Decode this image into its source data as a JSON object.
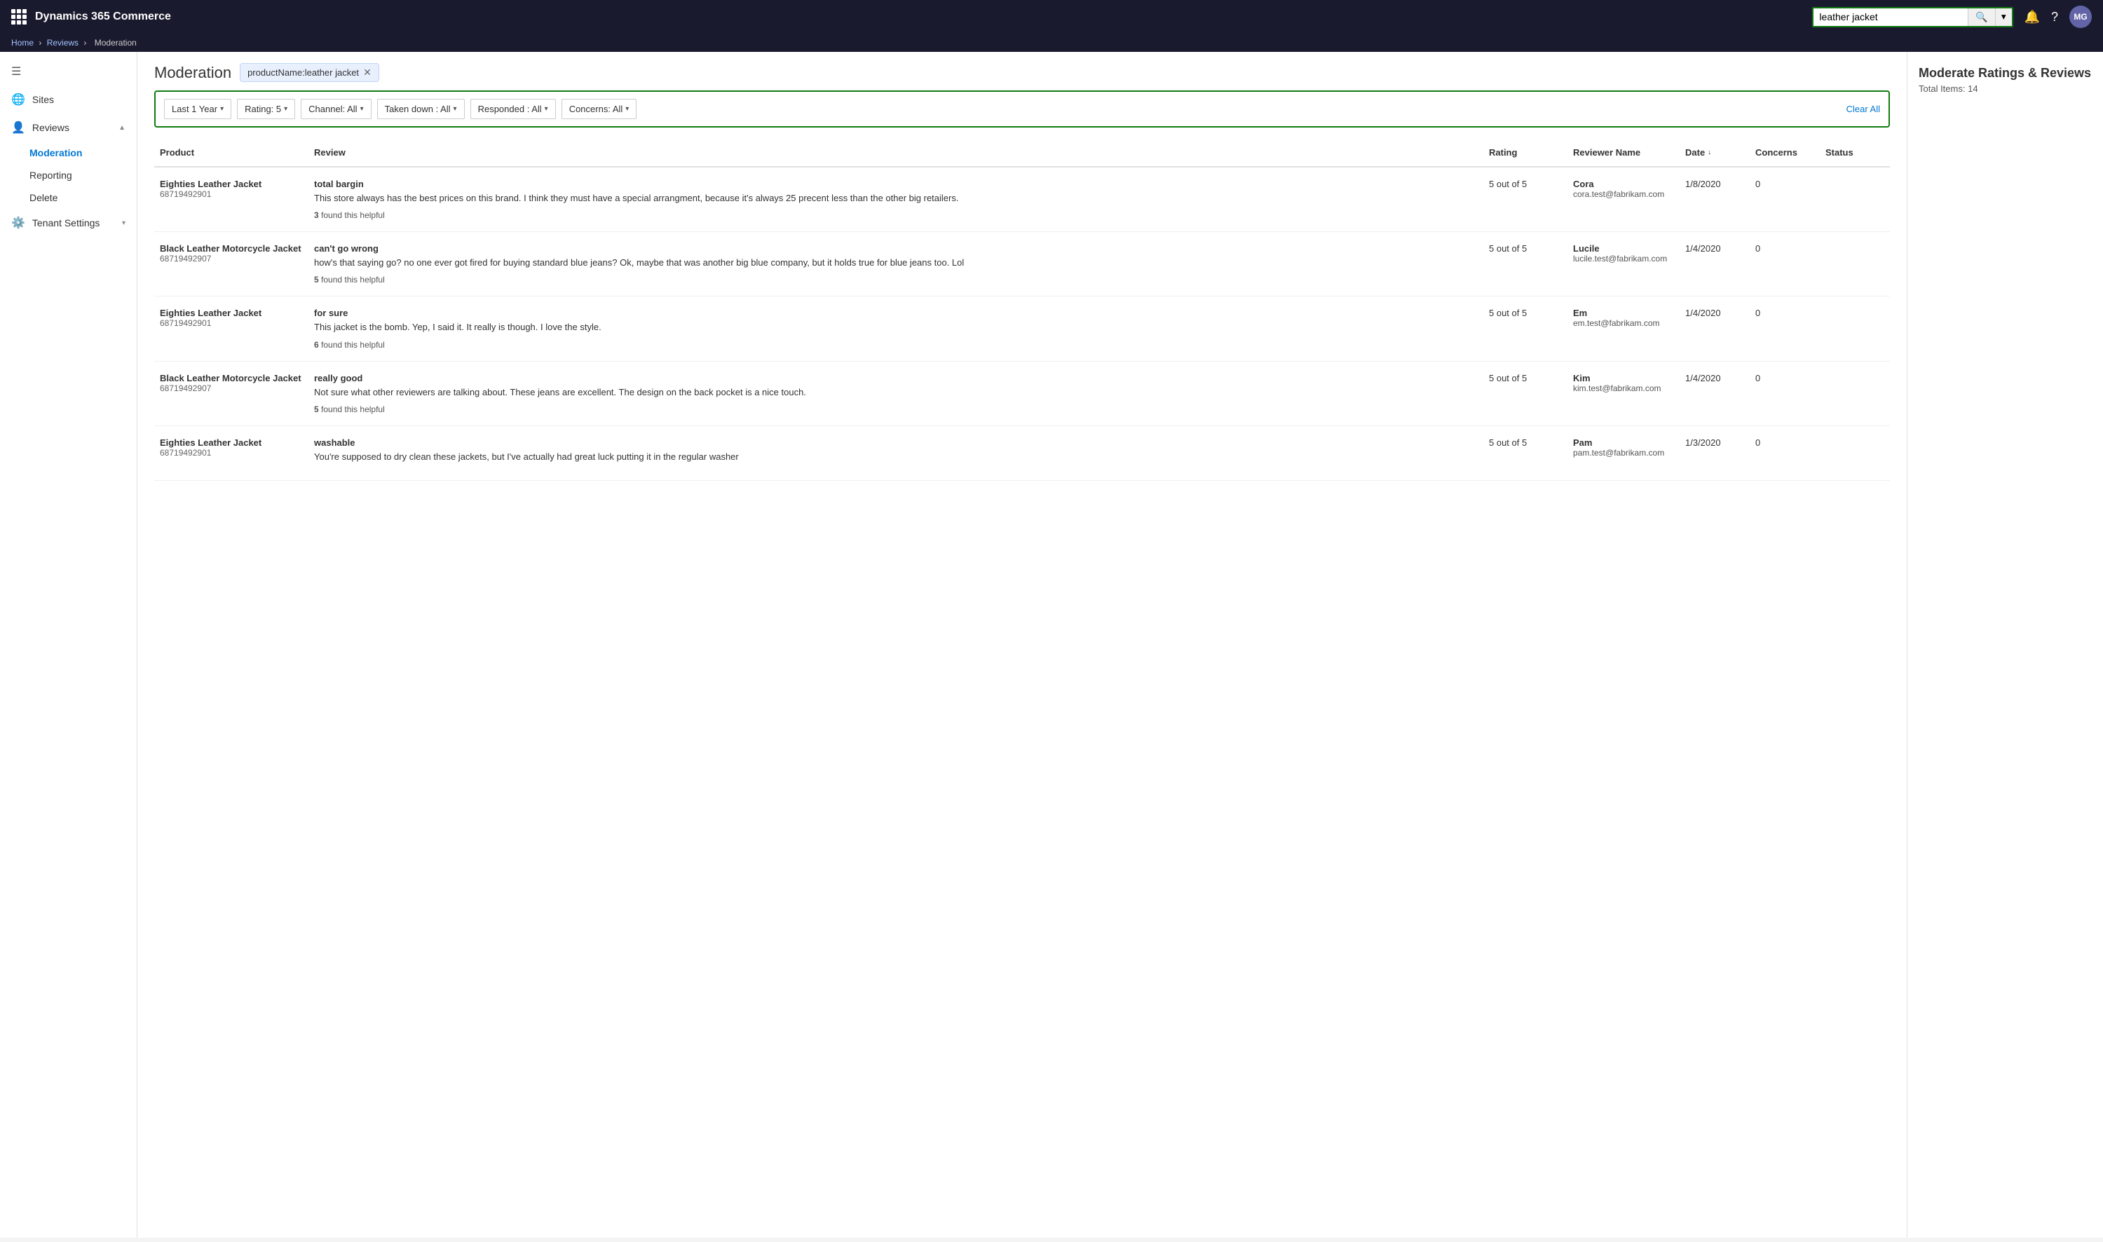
{
  "app": {
    "title": "Dynamics 365 Commerce",
    "avatar": "MG"
  },
  "search": {
    "value": "leather jacket",
    "placeholder": "leather jacket"
  },
  "breadcrumb": {
    "items": [
      "Home",
      "Reviews",
      "Moderation"
    ]
  },
  "sidebar": {
    "items": [
      {
        "id": "sites",
        "label": "Sites",
        "icon": "🌐",
        "type": "link"
      },
      {
        "id": "reviews",
        "label": "Reviews",
        "icon": "👤",
        "type": "expandable",
        "expanded": true,
        "subitems": [
          {
            "id": "moderation",
            "label": "Moderation",
            "active": true
          },
          {
            "id": "reporting",
            "label": "Reporting"
          },
          {
            "id": "delete",
            "label": "Delete"
          }
        ]
      },
      {
        "id": "tenant-settings",
        "label": "Tenant Settings",
        "icon": "⚙️",
        "type": "expandable"
      }
    ]
  },
  "page": {
    "title": "Moderation",
    "tag": "productName:leather jacket",
    "filters": {
      "period": "Last 1 Year",
      "rating": "Rating: 5",
      "channel": "Channel: All",
      "taken_down": "Taken down : All",
      "responded": "Responded : All",
      "concerns": "Concerns: All",
      "clear_label": "Clear All"
    }
  },
  "table": {
    "headers": [
      "Product",
      "Review",
      "Rating",
      "Reviewer Name",
      "Date",
      "Concerns",
      "Status"
    ],
    "rows": [
      {
        "product_name": "Eighties Leather Jacket",
        "product_id": "68719492901",
        "review_title": "total bargin",
        "review_body": "This store always has the best prices on this brand. I think they must have a special arrangment, because it's always 25 precent less than the other big retailers.",
        "helpful_count": "3",
        "helpful_text": "found this helpful",
        "rating": "5 out of 5",
        "reviewer_name": "Cora",
        "reviewer_email": "cora.test@fabrikam.com",
        "date": "1/8/2020",
        "concerns": "0",
        "status": ""
      },
      {
        "product_name": "Black Leather Motorcycle Jacket",
        "product_id": "68719492907",
        "review_title": "can't go wrong",
        "review_body": "how's that saying go? no one ever got fired for buying standard blue jeans? Ok, maybe that was another big blue company, but it holds true for blue jeans too. Lol",
        "helpful_count": "5",
        "helpful_text": "found this helpful",
        "rating": "5 out of 5",
        "reviewer_name": "Lucile",
        "reviewer_email": "lucile.test@fabrikam.com",
        "date": "1/4/2020",
        "concerns": "0",
        "status": ""
      },
      {
        "product_name": "Eighties Leather Jacket",
        "product_id": "68719492901",
        "review_title": "for sure",
        "review_body": "This jacket is the bomb. Yep, I said it. It really is though. I love the style.",
        "helpful_count": "6",
        "helpful_text": "found this helpful",
        "rating": "5 out of 5",
        "reviewer_name": "Em",
        "reviewer_email": "em.test@fabrikam.com",
        "date": "1/4/2020",
        "concerns": "0",
        "status": ""
      },
      {
        "product_name": "Black Leather Motorcycle Jacket",
        "product_id": "68719492907",
        "review_title": "really good",
        "review_body": "Not sure what other reviewers are talking about. These jeans are excellent. The design on the back pocket is a nice touch.",
        "helpful_count": "5",
        "helpful_text": "found this helpful",
        "rating": "5 out of 5",
        "reviewer_name": "Kim",
        "reviewer_email": "kim.test@fabrikam.com",
        "date": "1/4/2020",
        "concerns": "0",
        "status": ""
      },
      {
        "product_name": "Eighties Leather Jacket",
        "product_id": "68719492901",
        "review_title": "washable",
        "review_body": "You're supposed to dry clean these jackets, but I've actually had great luck putting it in the regular washer",
        "helpful_count": "",
        "helpful_text": "",
        "rating": "5 out of 5",
        "reviewer_name": "Pam",
        "reviewer_email": "pam.test@fabrikam.com",
        "date": "1/3/2020",
        "concerns": "0",
        "status": ""
      }
    ]
  },
  "right_panel": {
    "title": "Moderate Ratings & Reviews",
    "total_label": "Total Items:",
    "total_count": "14"
  }
}
